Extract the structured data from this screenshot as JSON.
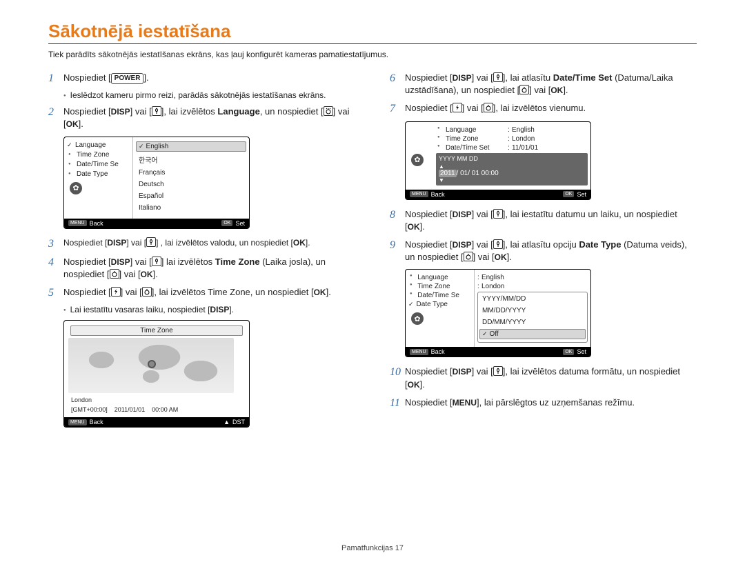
{
  "title": "Sākotnējā iestatīšana",
  "subtitle": "Tiek parādīts sākotnējās iestatīšanas ekrāns, kas ļauj konfigurēt kameras pamatiestatījumus.",
  "labels": {
    "power": "POWER",
    "disp": "DISP",
    "ok": "OK",
    "menu": "MENU",
    "back": "Back",
    "set": "Set",
    "dst": "DST"
  },
  "steps": {
    "s1": "Nospiediet [",
    "s1b": "].",
    "s1_bullet": "Ieslēdzot kameru pirmo reizi, parādās sākotnējās iestatīšanas ekrāns.",
    "s2a": "Nospiediet [",
    "s2b": "] vai [",
    "s2c": "], lai izvēlētos ",
    "s2_lang": "Language",
    "s2d": ", un nospiediet [",
    "s2e": "] vai [",
    "s2f": "].",
    "s3": "Nospiediet [",
    "s3b": "] vai [",
    "s3c": "] , lai izvēlētos valodu, un nospiediet [",
    "s3d": "].",
    "s4a": "Nospiediet [",
    "s4b": "] vai [",
    "s4c": "] lai izvēlētos ",
    "s4_tz": "Time Zone",
    "s4d": " (Laika josla), un nospiediet [",
    "s4e": "] vai [",
    "s4f": "].",
    "s5a": "Nospiediet [",
    "s5b": "] vai [",
    "s5c": "], lai izvēlētos Time Zone, un nospiediet [",
    "s5d": "].",
    "s5_bullet": "Lai iestatītu vasaras laiku, nospiediet [",
    "s5_bullet2": "].",
    "s6a": "Nospiediet [",
    "s6b": "] vai [",
    "s6c": "], lai atlasītu ",
    "s6_dts": "Date/Time Set",
    "s6d": " (Datuma/Laika uzstādīšana), un nospiediet [",
    "s6e": "] vai [",
    "s6f": "].",
    "s7a": "Nospiediet [",
    "s7b": "] vai [",
    "s7c": "], lai izvēlētos vienumu.",
    "s8a": "Nospiediet [",
    "s8b": "] vai [",
    "s8c": "], lai iestatītu datumu un laiku, un nospiediet [",
    "s8d": "].",
    "s9a": "Nospiediet [",
    "s9b": "] vai [",
    "s9c": "], lai atlasītu opciju ",
    "s9_dt": "Date Type",
    "s9d": " (Datuma veids), un nospiediet [",
    "s9e": "] vai [",
    "s9f": "].",
    "s10a": "Nospiediet [",
    "s10b": "] vai [",
    "s10c": "], lai izvēlētos datuma formātu, un nospiediet [",
    "s10d": "].",
    "s11a": "Nospiediet [",
    "s11b": "], lai pārslēgtos uz uzņemšanas režīmu."
  },
  "screen1": {
    "left": [
      "Language",
      "Time Zone",
      "Date/Time Se",
      "Date Type"
    ],
    "options": [
      "English",
      "한국어",
      "Français",
      "Deutsch",
      "Español",
      "Italiano"
    ]
  },
  "screen_tz": {
    "header": "Time Zone",
    "city": "London",
    "gmt": "[GMT+00:00]",
    "date": "2011/01/01",
    "time": "00:00 AM"
  },
  "screen_dt": {
    "rows": [
      {
        "k": "Language",
        "v": "English"
      },
      {
        "k": "Time Zone",
        "v": "London"
      },
      {
        "k": "Date/Time Set",
        "v": "11/01/01"
      }
    ],
    "box_label": "YYYY MM DD",
    "box_value_hl": "2011",
    "box_value_rest": "/ 01/ 01  00:00"
  },
  "screen_type": {
    "rows": [
      {
        "k": "Language",
        "v": "English"
      },
      {
        "k": "Time Zone",
        "v": "London"
      },
      {
        "k": "Date/Time Se",
        "v": ""
      },
      {
        "k": "Date Type",
        "v": ""
      }
    ],
    "options": [
      "YYYY/MM/DD",
      "MM/DD/YYYY",
      "DD/MM/YYYY",
      "Off"
    ]
  },
  "footer": "Pamatfunkcijas  17"
}
